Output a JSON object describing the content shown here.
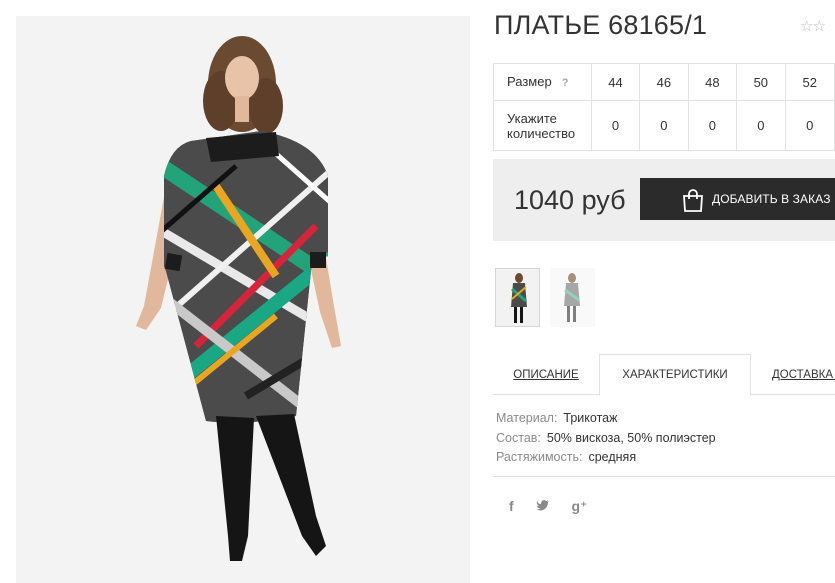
{
  "product": {
    "title": "ПЛАТЬЕ 68165/1",
    "rating_stars": "☆☆"
  },
  "sizes": {
    "size_label": "Размер",
    "help": "?",
    "quantity_label": "Укажите количество",
    "items": [
      {
        "size": "44",
        "qty": "0"
      },
      {
        "size": "46",
        "qty": "0"
      },
      {
        "size": "48",
        "qty": "0"
      },
      {
        "size": "50",
        "qty": "0"
      },
      {
        "size": "52",
        "qty": "0"
      }
    ]
  },
  "price": {
    "value": "1040 руб",
    "add_button": "ДОБАВИТЬ В ЗАКАЗ"
  },
  "tabs": [
    {
      "label": "ОПИСАНИЕ",
      "active": false
    },
    {
      "label": "ХАРАКТЕРИСТИКИ",
      "active": true
    },
    {
      "label": "ДОСТАВКА И",
      "active": false
    }
  ],
  "characteristics": [
    {
      "key": "Материал:",
      "value": "Трикотаж"
    },
    {
      "key": "Состав:",
      "value": "50% вискоза, 50% полиэстер"
    },
    {
      "key": "Растяжимость:",
      "value": "средняя"
    }
  ],
  "social": {
    "facebook": "f",
    "twitter": "🐦",
    "google": "g⁺"
  },
  "colors": {
    "button_bg": "#2b2b2b",
    "price_box_bg": "#eeeeee",
    "border": "#e2e2e2",
    "muted_text": "#8a8a8a"
  }
}
